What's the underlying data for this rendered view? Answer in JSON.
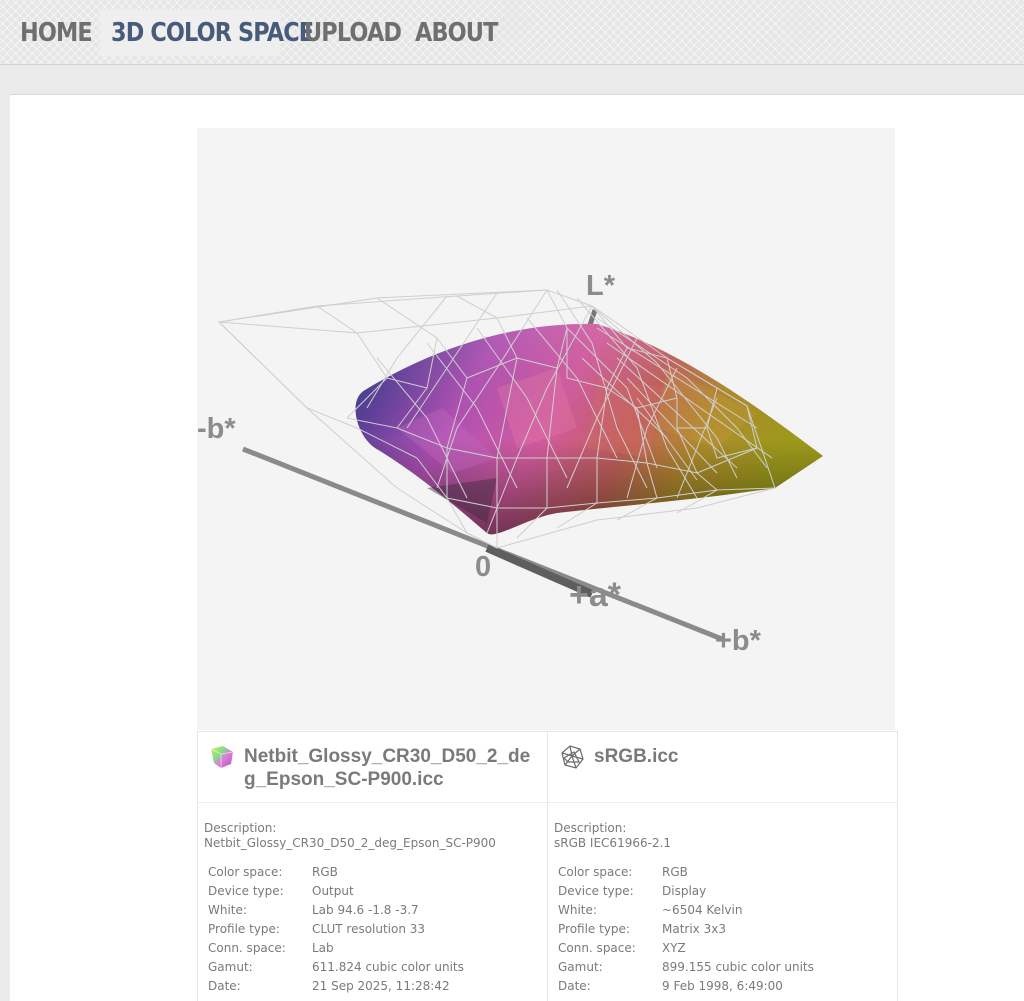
{
  "nav": {
    "items": [
      {
        "label": "HOME",
        "active": false
      },
      {
        "label": "3D COLOR SPACE",
        "active": true
      },
      {
        "label": "UPLOAD",
        "active": false
      },
      {
        "label": "ABOUT",
        "active": false
      }
    ],
    "active_color": "#475b7c",
    "text_color": "#6f6f6f"
  },
  "viewer": {
    "axis_labels": {
      "l_star": "L*",
      "minus_b": "-b*",
      "zero": "0",
      "plus_a": "+a*",
      "plus_b": "+b*"
    }
  },
  "profiles": [
    {
      "file_name": "Netbit_Glossy_CR30_D50_2_deg_Epson_SC-P900.icc",
      "icon": "gamut-solid-icon",
      "description_label": "Description:",
      "description": "Netbit_Glossy_CR30_D50_2_deg_Epson_SC-P900",
      "properties": [
        {
          "label": "Color space:",
          "value": "RGB"
        },
        {
          "label": "Device type:",
          "value": "Output"
        },
        {
          "label": "White:",
          "value": "Lab 94.6 -1.8 -3.7"
        },
        {
          "label": "Profile type:",
          "value": "CLUT resolution 33"
        },
        {
          "label": "Conn. space:",
          "value": "Lab"
        },
        {
          "label": "Gamut:",
          "value": "611.824 cubic color units"
        },
        {
          "label": "Date:",
          "value": "21 Sep 2025, 11:28:42"
        }
      ]
    },
    {
      "file_name": "sRGB.icc",
      "icon": "gamut-wireframe-icon",
      "description_label": "Description:",
      "description": "sRGB IEC61966-2.1",
      "properties": [
        {
          "label": "Color space:",
          "value": "RGB"
        },
        {
          "label": "Device type:",
          "value": "Display"
        },
        {
          "label": "White:",
          "value": "~6504 Kelvin"
        },
        {
          "label": "Profile type:",
          "value": "Matrix 3x3"
        },
        {
          "label": "Conn. space:",
          "value": "XYZ"
        },
        {
          "label": "Gamut:",
          "value": "899.155 cubic color units"
        },
        {
          "label": "Date:",
          "value": "9 Feb 1998, 6:49:00"
        }
      ]
    }
  ]
}
